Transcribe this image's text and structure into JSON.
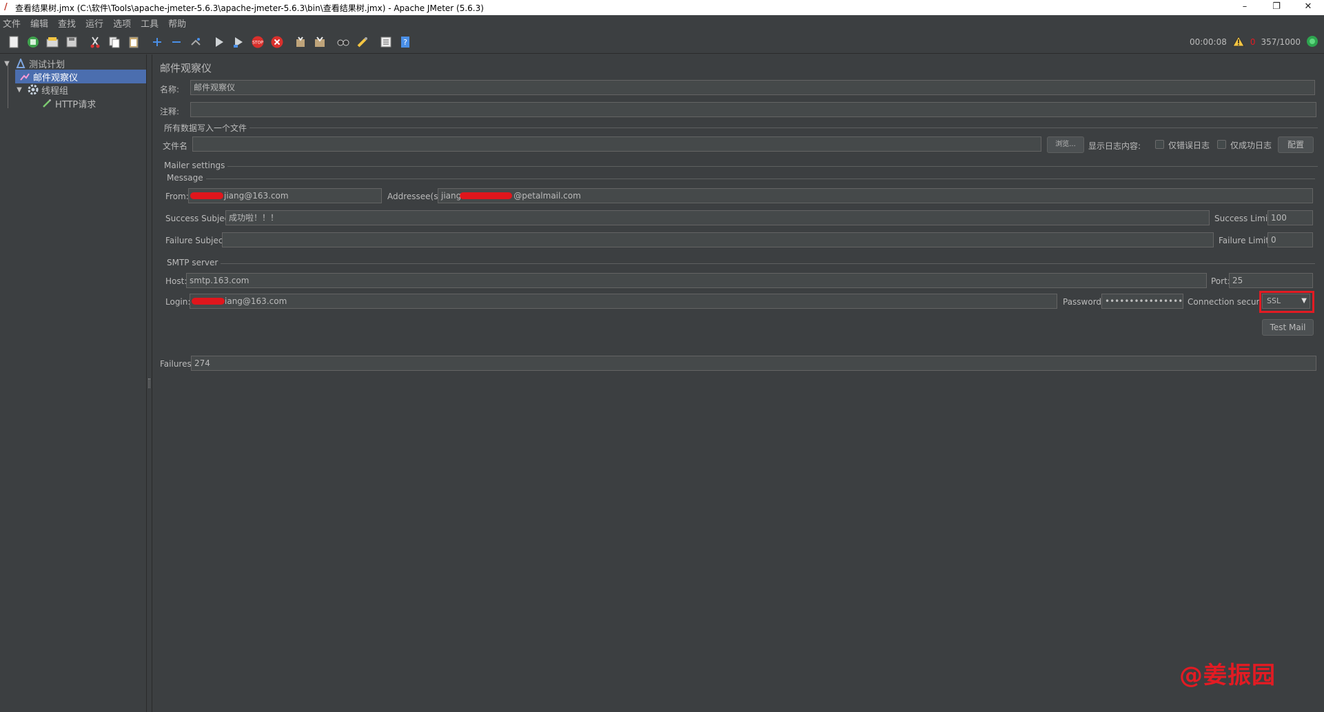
{
  "window": {
    "title": "查看结果树.jmx (C:\\软件\\Tools\\apache-jmeter-5.6.3\\apache-jmeter-5.6.3\\bin\\查看结果树.jmx) - Apache JMeter (5.6.3)",
    "minimize": "–",
    "maximize": "❐",
    "close": "✕"
  },
  "menu": [
    "文件",
    "编辑",
    "查找",
    "运行",
    "选项",
    "工具",
    "帮助"
  ],
  "toolbar_status": {
    "elapsed": "00:00:08",
    "warnings": "0",
    "threads": "357/1000"
  },
  "tree": {
    "root": "测试计划",
    "items": [
      "邮件观察仪",
      "线程组",
      "HTTP请求"
    ]
  },
  "panel": {
    "title": "邮件观察仪",
    "name_label": "名称:",
    "name_value": "邮件观察仪",
    "comment_label": "注释:",
    "comment_value": "",
    "file_section": "所有数据写入一个文件",
    "filename_label": "文件名",
    "filename_value": "",
    "browse_button": "浏览...",
    "log_display_label": "显示日志内容:",
    "errors_only_label": "仅错误日志",
    "success_only_label": "仅成功日志",
    "configure_button": "配置"
  },
  "mailer": {
    "section": "Mailer settings",
    "message_section": "Message",
    "from_label": "From:",
    "from_value": "jiang@163.com",
    "addressee_label": "Addressee(s):",
    "addressee_prefix": "jiang",
    "addressee_suffix": "@petalmail.com",
    "success_subject_label": "Success Subject:",
    "success_subject_value": "成功啦！！！",
    "success_limit_label": "Success Limit:",
    "success_limit_value": "100",
    "failure_subject_label": "Failure Subject:",
    "failure_subject_value": "",
    "failure_limit_label": "Failure Limit:",
    "failure_limit_value": "0",
    "smtp_section": "SMTP server",
    "host_label": "Host:",
    "host_value": "smtp.163.com",
    "port_label": "Port:",
    "port_value": "25",
    "login_label": "Login:",
    "login_value": "iang@163.com",
    "password_label": "Password:",
    "password_value": "••••••••••••••••",
    "security_label": "Connection security:",
    "security_value": "SSL",
    "test_mail_button": "Test Mail"
  },
  "failures": {
    "label": "Failures:",
    "value": "274"
  },
  "watermark": "@姜振园",
  "colors": {
    "background": "#3c3f41",
    "selection": "#4b6eaf",
    "highlight": "#e31b23"
  }
}
